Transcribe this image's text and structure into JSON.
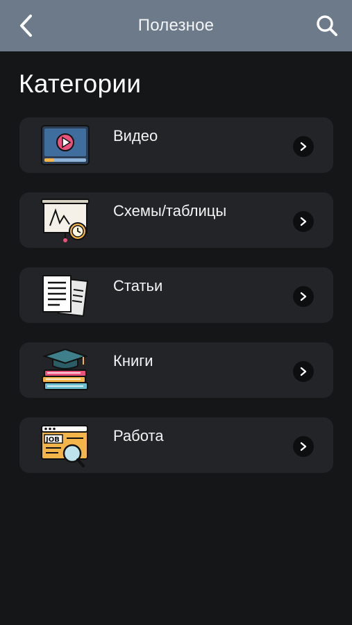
{
  "header": {
    "title": "Полезное",
    "back_icon": "chevron-left-icon",
    "search_icon": "search-icon",
    "bg_color": "#6c7a89"
  },
  "section": {
    "title": "Категории"
  },
  "categories": [
    {
      "label": "Видео",
      "icon": "video-player-icon"
    },
    {
      "label": "Схемы/таблицы",
      "icon": "presentation-board-icon"
    },
    {
      "label": "Статьи",
      "icon": "documents-icon"
    },
    {
      "label": "Книги",
      "icon": "books-graduation-cap-icon"
    },
    {
      "label": "Работа",
      "icon": "job-search-icon"
    }
  ],
  "colors": {
    "background": "#151618",
    "card": "#232427",
    "text": "#ffffff"
  }
}
